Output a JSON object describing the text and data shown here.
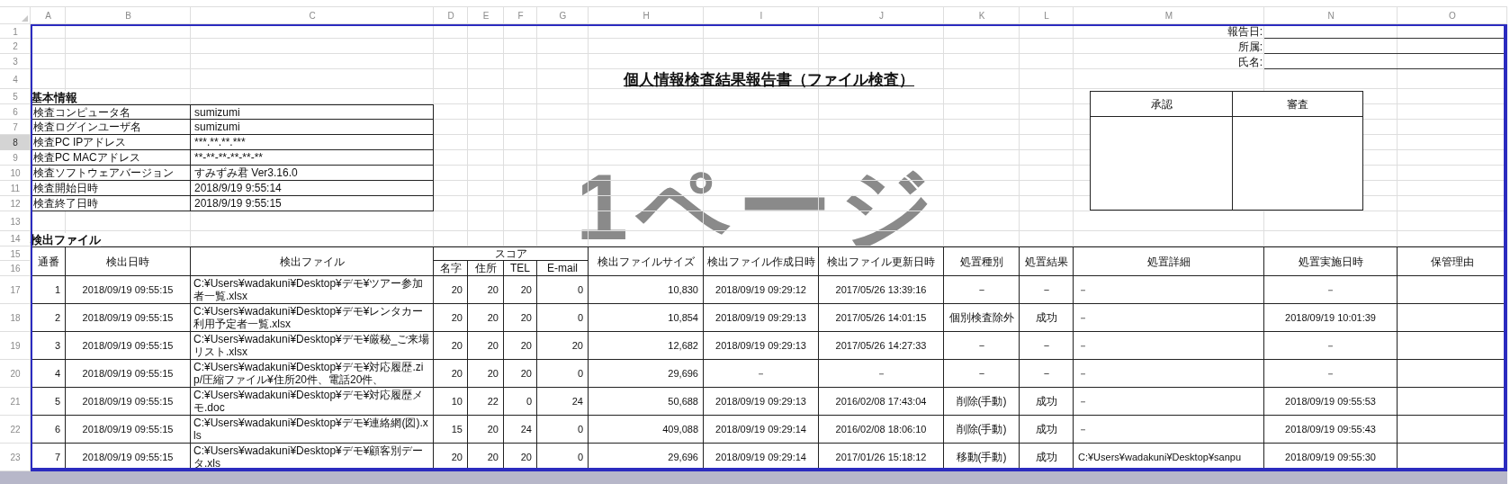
{
  "column_headers": [
    "A",
    "B",
    "C",
    "D",
    "E",
    "F",
    "G",
    "H",
    "I",
    "J",
    "K",
    "L",
    "M",
    "N",
    "O"
  ],
  "row_headers": [
    {
      "label": "1",
      "selected": false
    },
    {
      "label": "2",
      "selected": false
    },
    {
      "label": "3",
      "selected": false
    },
    {
      "label": "4",
      "selected": false
    },
    {
      "label": "5",
      "selected": false
    },
    {
      "label": "6",
      "selected": false
    },
    {
      "label": "7",
      "selected": false
    },
    {
      "label": "8",
      "selected": true
    },
    {
      "label": "9",
      "selected": false
    },
    {
      "label": "10",
      "selected": false
    },
    {
      "label": "11",
      "selected": false
    },
    {
      "label": "12",
      "selected": false
    },
    {
      "label": "13",
      "selected": false
    },
    {
      "label": "14",
      "selected": false
    },
    {
      "label": "15",
      "selected": false
    },
    {
      "label": "16",
      "selected": false
    },
    {
      "label": "17",
      "selected": false
    },
    {
      "label": "18",
      "selected": false
    },
    {
      "label": "19",
      "selected": false
    },
    {
      "label": "20",
      "selected": false
    },
    {
      "label": "21",
      "selected": false
    },
    {
      "label": "22",
      "selected": false
    },
    {
      "label": "23",
      "selected": false
    }
  ],
  "report_fields": [
    {
      "label": "報告日:"
    },
    {
      "label": "所属:"
    },
    {
      "label": "氏名:"
    }
  ],
  "title": "個人情報検査結果報告書（ファイル検査）",
  "basic_info": {
    "heading": "基本情報",
    "rows": [
      {
        "label": "検査コンピュータ名",
        "value": "sumizumi"
      },
      {
        "label": "検査ログインユーザ名",
        "value": "sumizumi"
      },
      {
        "label": "検査PC IPアドレス",
        "value": "***.**.**.***"
      },
      {
        "label": "検査PC MACアドレス",
        "value": "**-**-**-**-**-**"
      },
      {
        "label": "検査ソフトウェアバージョン",
        "value": "すみずみ君 Ver3.16.0"
      },
      {
        "label": "検査開始日時",
        "value": "2018/9/19 9:55:14"
      },
      {
        "label": "検査終了日時",
        "value": "2018/9/19 9:55:15"
      }
    ]
  },
  "approval": {
    "columns": [
      "承認",
      "審査"
    ]
  },
  "page_label": "1ページ",
  "detected_files": {
    "heading": "検出ファイル",
    "column_groups": [
      {
        "label": "スコア"
      }
    ],
    "columns": [
      {
        "label": "通番",
        "grouped": false
      },
      {
        "label": "検出日時",
        "grouped": false
      },
      {
        "label": "検出ファイル",
        "grouped": false
      },
      {
        "label": "名字",
        "grouped": true
      },
      {
        "label": "住所",
        "grouped": true
      },
      {
        "label": "TEL",
        "grouped": true
      },
      {
        "label": "E-mail",
        "grouped": true
      },
      {
        "label": "検出ファイルサイズ",
        "grouped": false
      },
      {
        "label": "検出ファイル作成日時",
        "grouped": false
      },
      {
        "label": "検出ファイル更新日時",
        "grouped": false
      },
      {
        "label": "処置種別",
        "grouped": false
      },
      {
        "label": "処置結果",
        "grouped": false
      },
      {
        "label": "処置詳細",
        "grouped": false
      },
      {
        "label": "処置実施日時",
        "grouped": false
      },
      {
        "label": "保管理由",
        "grouped": false
      }
    ],
    "rows": [
      [
        "1",
        "2018/09/19 09:55:15",
        "C:¥Users¥wadakuni¥Desktop¥デモ¥ツアー参加者一覧.xlsx",
        "20",
        "20",
        "20",
        "0",
        "10,830",
        "2018/09/19 09:29:12",
        "2017/05/26 13:39:16",
        "－",
        "－",
        "－",
        "－"
      ],
      [
        "2",
        "2018/09/19 09:55:15",
        "C:¥Users¥wadakuni¥Desktop¥デモ¥レンタカー利用予定者一覧.xlsx",
        "20",
        "20",
        "20",
        "0",
        "10,854",
        "2018/09/19 09:29:13",
        "2017/05/26 14:01:15",
        "個別検査除外",
        "成功",
        "－",
        "2018/09/19 10:01:39"
      ],
      [
        "3",
        "2018/09/19 09:55:15",
        "C:¥Users¥wadakuni¥Desktop¥デモ¥厳秘_ご来場リスト.xlsx",
        "20",
        "20",
        "20",
        "20",
        "12,682",
        "2018/09/19 09:29:13",
        "2017/05/26 14:27:33",
        "－",
        "－",
        "－",
        "－"
      ],
      [
        "4",
        "2018/09/19 09:55:15",
        "C:¥Users¥wadakuni¥Desktop¥デモ¥対応履歴.zip/圧縮ファイル¥住所20件、電話20件、",
        "20",
        "20",
        "20",
        "0",
        "29,696",
        "－",
        "－",
        "－",
        "－",
        "－",
        "－"
      ],
      [
        "5",
        "2018/09/19 09:55:15",
        "C:¥Users¥wadakuni¥Desktop¥デモ¥対応履歴メモ.doc",
        "10",
        "22",
        "0",
        "24",
        "50,688",
        "2018/09/19 09:29:13",
        "2016/02/08 17:43:04",
        "削除(手動)",
        "成功",
        "－",
        "2018/09/19 09:55:53"
      ],
      [
        "6",
        "2018/09/19 09:55:15",
        "C:¥Users¥wadakuni¥Desktop¥デモ¥連絡網(図).xls",
        "15",
        "20",
        "24",
        "0",
        "409,088",
        "2018/09/19 09:29:14",
        "2016/02/08 18:06:10",
        "削除(手動)",
        "成功",
        "－",
        "2018/09/19 09:55:43"
      ],
      [
        "7",
        "2018/09/19 09:55:15",
        "C:¥Users¥wadakuni¥Desktop¥デモ¥顧客別データ.xls",
        "20",
        "20",
        "20",
        "0",
        "29,696",
        "2018/09/19 09:29:14",
        "2017/01/26 15:18:12",
        "移動(手動)",
        "成功",
        "C:¥Users¥wadakuni¥Desktop¥sanpu",
        "2018/09/19 09:55:30"
      ]
    ]
  }
}
